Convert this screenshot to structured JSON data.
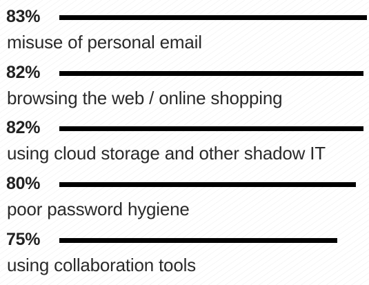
{
  "chart_data": {
    "type": "bar",
    "orientation": "horizontal",
    "categories": [
      "misuse of personal email",
      "browsing the web / online shopping",
      "using cloud storage and other shadow IT",
      "poor password hygiene",
      "using collaboration tools"
    ],
    "value_labels": [
      "83%",
      "82%",
      "82%",
      "80%",
      "75%"
    ],
    "values": [
      83,
      82,
      82,
      80,
      75
    ],
    "bar_color": "#000000",
    "grid": false,
    "legend": "none"
  }
}
